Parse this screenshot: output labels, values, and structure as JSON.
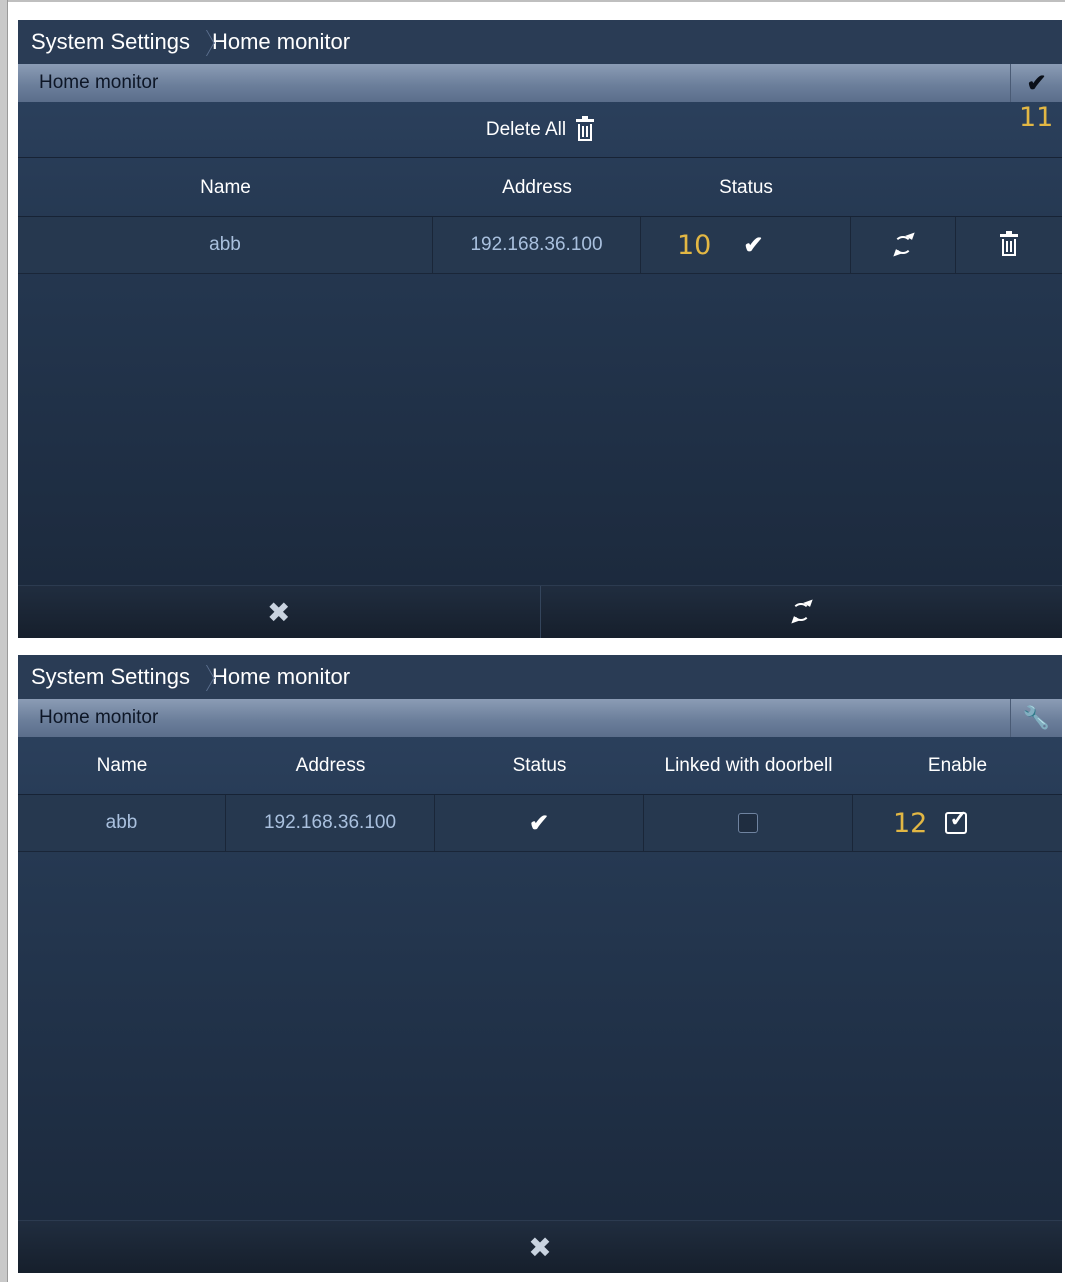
{
  "panel1": {
    "breadcrumb": {
      "root": "System Settings",
      "current": "Home monitor"
    },
    "title": "Home monitor",
    "confirm_icon": "checkmark-icon",
    "annotation_confirm": "11",
    "delete_all_label": "Delete All",
    "delete_all_icon": "trash-icon",
    "columns": {
      "name": "Name",
      "address": "Address",
      "status": "Status"
    },
    "rows": [
      {
        "name": "abb",
        "address": "192.168.36.100",
        "annotation": "10",
        "status_icon": "checkmark-icon",
        "refresh_icon": "refresh-icon",
        "delete_icon": "trash-icon"
      }
    ],
    "bottom": {
      "cancel_icon": "close-icon",
      "refresh_icon": "refresh-icon"
    }
  },
  "panel2": {
    "breadcrumb": {
      "root": "System Settings",
      "current": "Home monitor"
    },
    "title": "Home monitor",
    "settings_icon": "wrench-icon",
    "columns": {
      "name": "Name",
      "address": "Address",
      "status": "Status",
      "linked": "Linked with doorbell",
      "enable": "Enable"
    },
    "rows": [
      {
        "name": "abb",
        "address": "192.168.36.100",
        "status_icon": "checkmark-icon",
        "linked_with_doorbell": false,
        "enable": true,
        "annotation": "12"
      }
    ],
    "bottom": {
      "cancel_icon": "close-icon"
    }
  },
  "colors": {
    "annotation": "#e2b744",
    "panel_bg": "#253851",
    "title_bar": "#6c7f9b",
    "cell_text": "#a9c0de"
  }
}
